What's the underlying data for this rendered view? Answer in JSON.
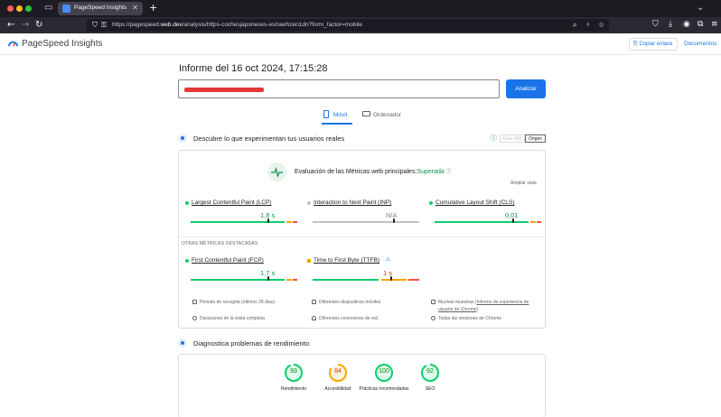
{
  "browser": {
    "tab_title": "PageSpeed Insights",
    "tab_close": "✕",
    "new_tab": "+",
    "url_prefix": "https://pagespeed.",
    "url_domain": "web.dev",
    "url_rest": "/analysis/https-cochesjaponeses-es/rawhzen1dn?form_factor=mobile"
  },
  "header": {
    "brand": "PageSpeed Insights",
    "copy_link": "Copiar enlace",
    "docs": "Documentos"
  },
  "report": {
    "title": "Informe del 16 oct 2024, 17:15:28",
    "analyze_button": "Analizar"
  },
  "device_tabs": [
    {
      "label": "Móvil",
      "selected": true
    },
    {
      "label": "Ordenador",
      "selected": false
    }
  ],
  "field_section": {
    "title": "Descubre lo que experimentan tus usuarios reales",
    "source_url": "Esta URL",
    "source_origin": "Origen"
  },
  "cwv": {
    "title": "Evaluación de las Métricas web principales:",
    "status": "Superada",
    "expand": "Ampliar vista"
  },
  "core_metrics": [
    {
      "name": "Largest Contentful Paint (LCP)",
      "value": "1,8 s",
      "status": "good",
      "marker": 0.72
    },
    {
      "name": "Interaction to Next Paint (INP)",
      "value": "N/A",
      "status": "none",
      "marker": 0.75
    },
    {
      "name": "Cumulative Layout Shift (CLS)",
      "value": "0,01",
      "status": "good",
      "marker": 0.73
    }
  ],
  "other_title": "OTRAS MÉTRICAS DESTACADAS",
  "other_metrics": [
    {
      "name": "First Contentful Paint (FCP)",
      "value": "1,7 s",
      "status": "good",
      "marker": 0.72
    },
    {
      "name": "Time to First Byte (TTFB)",
      "value": "1 s",
      "status": "average",
      "marker": 0.73
    }
  ],
  "footer_items": [
    {
      "text": "Periodo de recogida (últimos 28 días)"
    },
    {
      "text": "Diferentes dispositivos móviles"
    },
    {
      "text": "Muchas muestras (",
      "link": "Informe de experiencia de usuario de Chrome",
      "suffix": ")"
    },
    {
      "text": "Duraciones de la visita completa"
    },
    {
      "text": "Diferentes conexiones de red"
    },
    {
      "text": "Todas las versiones de Chrome"
    }
  ],
  "diag_section": {
    "title": "Diagnostica problemas de rendimiento"
  },
  "scores": [
    {
      "label": "Rendimiento",
      "value": "93",
      "score": 0.93,
      "color": "#0cce6b",
      "text_color": "#008800"
    },
    {
      "label": "Accesibilidad",
      "value": "84",
      "score": 0.84,
      "color": "#ffa400",
      "text_color": "#c33300"
    },
    {
      "label": "Prácticas recomendadas",
      "value": "100",
      "score": 1.0,
      "color": "#0cce6b",
      "text_color": "#008800"
    },
    {
      "label": "SEO",
      "value": "92",
      "score": 0.92,
      "color": "#0cce6b",
      "text_color": "#008800"
    }
  ],
  "colors": {
    "accent": "#1a73e8",
    "good": "#0cce6b",
    "average": "#ffa400",
    "poor": "#ff4e42",
    "none": "#bdc1c6"
  }
}
